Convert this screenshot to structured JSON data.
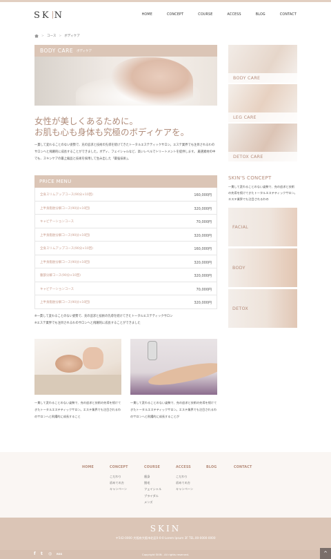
{
  "header": {
    "logo_left": "SK",
    "logo_right": "N",
    "nav": [
      "HOME",
      "CONCEPT",
      "COURSE",
      "ACCESS",
      "BLOG",
      "CONTACT"
    ]
  },
  "breadcrumb": [
    "コース",
    "ボディケア"
  ],
  "hero": {
    "title": "BODY CARE",
    "subtitle": "ボディケア"
  },
  "headline": {
    "line1": "女性が美しくあるために。",
    "line2": "お肌も心も身体も究極のボディケアを。"
  },
  "intro": "一貫して変わることのない姿勢で、充の追求と技術の先導を続けてきたトータルエステティックサロン。エステ業界でも注目されるわのサロンへと飛躍的に成長することができました。ボディ、フェイシャルなど、高いレベルでトリートメントを提供します。 厳選素材の中でも、スキンケアの最上級品と技術を採用して生み出した「最強技術」。",
  "price_menu": {
    "title": "PRICE MENU",
    "items": [
      {
        "name": "全身スリムアップコース(90分×10回)",
        "price": "160,000円"
      },
      {
        "name": "上半身脂肪分解コース(90分×10回)",
        "price": "320,000円"
      },
      {
        "name": "キャビテーションコース",
        "price": "70,000円"
      },
      {
        "name": "上半身脂肪分解コース(90分×10回)",
        "price": "320,000円"
      },
      {
        "name": "全身スリムアップコース(90分×10回)",
        "price": "160,000円"
      },
      {
        "name": "上半身脂肪分解コース(90分×10回)",
        "price": "320,000円"
      },
      {
        "name": "腹部分解コース(90分×10回)",
        "price": "320,000円"
      },
      {
        "name": "キャビテーションコース",
        "price": "70,000円"
      },
      {
        "name": "上半身脂肪分解コース(90分×10回)",
        "price": "320,000円"
      }
    ]
  },
  "notes": [
    "※一貫して変わることのない姿勢で、充の追求と技術の先導を続けてきたトータルエステティックサロン",
    "※エステ業界でも注目されるわのサロンへと飛躍的に成長することができました"
  ],
  "photo_texts": [
    "一貫して変わることのない姿勢で、充の追求と技術の先導を続けてきたトータルエステティックサロン。エステ業界でも注目されるわのサロンへと飛躍的に成長すること",
    "一貫して変わることのない姿勢で、充の追求と技術の先導を続けてきたトータルエステティックサロン。エステ業界でも注目されるわのサロンへと飛躍的に成長することが"
  ],
  "sidebar": {
    "boxes": [
      "BODY CARE",
      "LEG CARE",
      "DETOX CARE"
    ],
    "concept_title": "SKIN'S CONCEPT",
    "concept_text": "一貫して変わることのない姿勢で、充の追求と技術の先導を続けてきたトータルエステティックサロン。エステ業界でも注目されるわの",
    "tiles": [
      "FACIAL",
      "BODY",
      "DETOX"
    ]
  },
  "footer": {
    "cols": [
      {
        "title": "HOME",
        "items": []
      },
      {
        "title": "CONCEPT",
        "items": [
          "こだわり",
          "初めての方",
          "キャンペーン"
        ]
      },
      {
        "title": "COURSE",
        "items": [
          "痩身",
          "脱毛",
          "フェイシャル",
          "ブライダル",
          "メンズ"
        ]
      },
      {
        "title": "ACCESS",
        "items": [
          "こだわり",
          "初めての方",
          "キャンペーン"
        ]
      },
      {
        "title": "BLOG",
        "items": []
      },
      {
        "title": "CONTACT",
        "items": []
      }
    ],
    "logo": "SKIN",
    "address": "〒542-0000 大阪府大阪市北区0-0-0 Lorem Ipsum 3F TEL.00-0000-0000",
    "copyright": "Copyright SKIN . All rights reserved.",
    "social": [
      "f",
      "t",
      "◎",
      "RSS"
    ],
    "to_top": "^"
  }
}
